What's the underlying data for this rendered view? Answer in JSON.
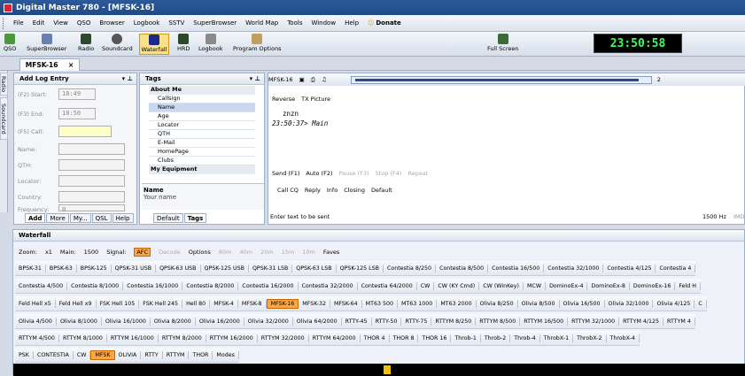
{
  "window": {
    "title": "Digital Master 780 - [MFSK-16]"
  },
  "menu": [
    "File",
    "Edit",
    "View",
    "QSO",
    "Browser",
    "Logbook",
    "SSTV",
    "SuperBrowser",
    "World Map",
    "Tools",
    "Window",
    "Help"
  ],
  "menu_donate": "Donate",
  "toolbar": {
    "buttons": [
      "QSO",
      "SuperBrowser",
      "Radio",
      "Soundcard",
      "Waterfall",
      "HRD",
      "Logbook",
      "Program Options"
    ],
    "fullscreen": "Full Screen",
    "clock": "23:50:58"
  },
  "doc_tab": {
    "label": "MFSK-16",
    "close": "×"
  },
  "side_tabs": [
    "Radio",
    "Soundcard"
  ],
  "log_entry": {
    "title": "Add Log Entry",
    "fields": [
      {
        "label": "(F2) Start:",
        "value": "18:49"
      },
      {
        "label": "(F3) End:",
        "value": "18:50"
      },
      {
        "label": "(F5) Call:",
        "value": ""
      },
      {
        "label": "Name:",
        "value": ""
      },
      {
        "label": "QTH:",
        "value": ""
      },
      {
        "label": "Locator:",
        "value": ""
      },
      {
        "label": "Country:",
        "value": ""
      },
      {
        "label": "Frequency:",
        "value": "0"
      }
    ],
    "tabs": [
      "Add",
      "More",
      "My...",
      "QSL",
      "Help"
    ]
  },
  "tags": {
    "title": "Tags",
    "group1": "About Me",
    "items": [
      "Callsign",
      "Name",
      "Age",
      "Locator",
      "QTH",
      "E-Mail",
      "HomePage",
      "Clubs"
    ],
    "group2": "My Equipment",
    "desc_title": "Name",
    "desc_text": "Your name",
    "tabs": [
      "Default",
      "Tags"
    ]
  },
  "mode_panel": {
    "mode": "MFSK-16",
    "freq_suffix": "2",
    "reverse": "Reverse",
    "tx_picture": "TX Picture",
    "rx_line1": "znzn",
    "rx_line2": "23:50:37> Main",
    "send": "Send (F1)",
    "auto": "Auto (F2)",
    "pause": "Pause (F3)",
    "stop": "Stop (F4)",
    "repeat": "Repeat",
    "macros": [
      "Call CQ",
      "Reply",
      "Info",
      "Closing",
      "Default"
    ],
    "input_hint": "Enter text to be sent",
    "status_hz": "1500 Hz",
    "status_imd": "IMD"
  },
  "waterfall": {
    "title": "Waterfall",
    "zoom_label": "Zoom:",
    "zoom": "x1",
    "main_label": "Main:",
    "main_value": "1500",
    "signal_label": "Signal:",
    "afc": "AFC",
    "decode": "Decode",
    "options": "Options",
    "bands": [
      "80m",
      "40m",
      "20m",
      "15m",
      "10m"
    ],
    "faves": "Faves",
    "row1": [
      "BPSK-31",
      "BPSK-63",
      "BPSK-125",
      "QPSK-31 USB",
      "QPSK-63 USB",
      "QPSK-125 USB",
      "QPSK-31 LSB",
      "QPSK-63 LSB",
      "QPSK-125 LSB",
      "Contestia 8/250",
      "Contestia 8/500",
      "Contestia 16/500",
      "Contestia 32/1000",
      "Contestia 4/125",
      "Contestia 4"
    ],
    "row2": [
      "Contestia 4/500",
      "Contestia 8/1000",
      "Contestia 16/1000",
      "Contestia 8/2000",
      "Contestia 16/2000",
      "Contestia 32/2000",
      "Contestia 64/2000",
      "CW",
      "CW (KY Cmd)",
      "CW (WinKey)",
      "MCW",
      "DominoEx-4",
      "DominoEx-8",
      "DominoEx-16",
      "Feld H"
    ],
    "row3": [
      "Feld Hell x5",
      "Feld Hell x9",
      "FSK Hell 105",
      "FSK Hell 245",
      "Hell 80",
      "MFSK-4",
      "MFSK-8",
      "MFSK-16",
      "MFSK-32",
      "MFSK-64",
      "MT63 500",
      "MT63 1000",
      "MT63 2000",
      "Olivia 8/250",
      "Olivia 8/500",
      "Olivia 16/500",
      "Olivia 32/1000",
      "Olivia 4/125",
      "C"
    ],
    "row4": [
      "Olivia 4/500",
      "Olivia 8/1000",
      "Olivia 16/1000",
      "Olivia 8/2000",
      "Olivia 16/2000",
      "Olivia 32/2000",
      "Olivia 64/2000",
      "RTTY-45",
      "RTTY-50",
      "RTTY-75",
      "RTTYM 8/250",
      "RTTYM 8/500",
      "RTTYM 16/500",
      "RTTYM 32/1000",
      "RTTYM 4/125",
      "RTTYM 4"
    ],
    "row5": [
      "RTTYM 4/500",
      "RTTYM 8/1000",
      "RTTYM 16/1000",
      "RTTYM 8/2000",
      "RTTYM 16/2000",
      "RTTYM 32/2000",
      "RTTYM 64/2000",
      "THOR 4",
      "THOR 8",
      "THOR 16",
      "Throb-1",
      "Throb-2",
      "Throb-4",
      "ThrobX-1",
      "ThrobX-2",
      "ThrobX-4"
    ],
    "row6": [
      "PSK",
      "CONTESTIA",
      "CW",
      "MFSK",
      "OLIVIA",
      "RTTY",
      "RTTYM",
      "THOR",
      "Modes"
    ]
  },
  "colors": {
    "selected_mode": "#fba646",
    "clock_fg": "#3cff5a"
  }
}
